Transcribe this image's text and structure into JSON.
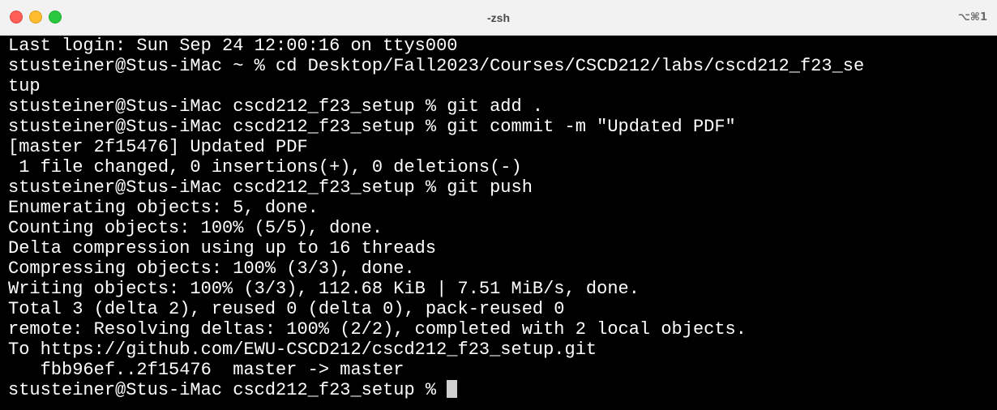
{
  "window": {
    "title": "-zsh",
    "shortcut": "⌥⌘1"
  },
  "terminal": {
    "lines": [
      "Last login: Sun Sep 24 12:00:16 on ttys000",
      "stusteiner@Stus-iMac ~ % cd Desktop/Fall2023/Courses/CSCD212/labs/cscd212_f23_se",
      "tup",
      "stusteiner@Stus-iMac cscd212_f23_setup % git add .",
      "stusteiner@Stus-iMac cscd212_f23_setup % git commit -m \"Updated PDF\"",
      "[master 2f15476] Updated PDF",
      " 1 file changed, 0 insertions(+), 0 deletions(-)",
      "stusteiner@Stus-iMac cscd212_f23_setup % git push",
      "Enumerating objects: 5, done.",
      "Counting objects: 100% (5/5), done.",
      "Delta compression using up to 16 threads",
      "Compressing objects: 100% (3/3), done.",
      "Writing objects: 100% (3/3), 112.68 KiB | 7.51 MiB/s, done.",
      "Total 3 (delta 2), reused 0 (delta 0), pack-reused 0",
      "remote: Resolving deltas: 100% (2/2), completed with 2 local objects.",
      "To https://github.com/EWU-CSCD212/cscd212_f23_setup.git",
      "   fbb96ef..2f15476  master -> master"
    ],
    "prompt": "stusteiner@Stus-iMac cscd212_f23_setup % "
  },
  "colors": {
    "background": "#000000",
    "foreground": "#ffffff",
    "titlebar": "#f2f2f2",
    "close": "#ff5f57",
    "minimize": "#febc2e",
    "zoom": "#28c840"
  }
}
